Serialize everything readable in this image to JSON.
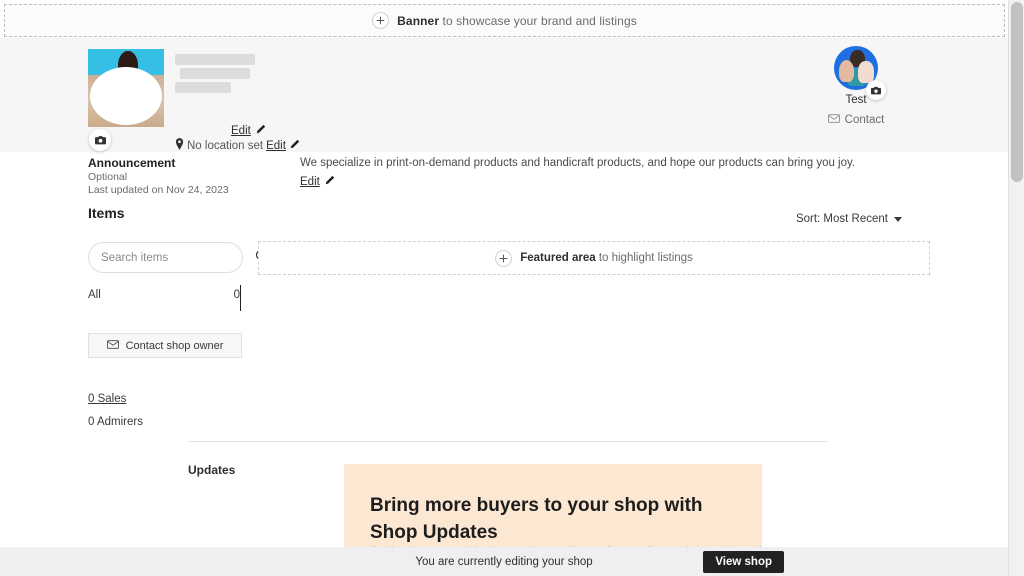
{
  "banner": {
    "icon": "plus-icon",
    "label_bold": "Banner",
    "label_rest": " to showcase your brand and listings"
  },
  "shop_header": {
    "avatar_camera_icon": "camera-icon",
    "shop_name_redacted": true,
    "edit_label": "Edit",
    "edit_icon": "pencil-icon",
    "location_icon": "location-pin-icon",
    "location_text": "No location set",
    "location_edit_label": "Edit"
  },
  "user": {
    "avatar_icon": "user-avatar",
    "camera_icon": "camera-icon",
    "name": "Test",
    "contact_icon": "envelope-icon",
    "contact_label": "Contact"
  },
  "announcement": {
    "title": "Announcement",
    "optional": "Optional",
    "last_updated": "Last updated on Nov 24, 2023",
    "text": "We specialize in print-on-demand products and handicraft products, and hope our products can bring you joy.",
    "edit_label": "Edit",
    "edit_icon": "pencil-icon"
  },
  "items": {
    "heading": "Items",
    "sort_label": "Sort: Most Recent",
    "sort_icon": "chevron-down-icon",
    "search_placeholder": "Search items",
    "search_value": "",
    "search_icon": "search-icon",
    "featured": {
      "icon": "plus-icon",
      "label_bold": "Featured area",
      "label_rest": " to highlight listings"
    },
    "filter": {
      "label": "All",
      "count": "0"
    },
    "contact_owner": {
      "icon": "envelope-icon",
      "label": "Contact shop owner"
    },
    "sales": "0 Sales",
    "admirers": "0 Admirers"
  },
  "updates": {
    "label": "Updates",
    "card_heading": "Bring more buyers to your shop with Shop Updates",
    "card_body": "Easily share shoppable photo updates with your fans on Etsy and on social media using the Sell on Etsy app. They appear on your shop home and on the Etsy"
  },
  "edit_bar": {
    "status_text": "You are currently editing your shop",
    "view_shop_label": "View shop"
  },
  "colors": {
    "header_band": "#f6f6f6",
    "updates_card": "#fce7d3",
    "view_shop_button": "#222222",
    "user_avatar_ring": "#1f6fe0",
    "edit_bar": "#efefef"
  }
}
